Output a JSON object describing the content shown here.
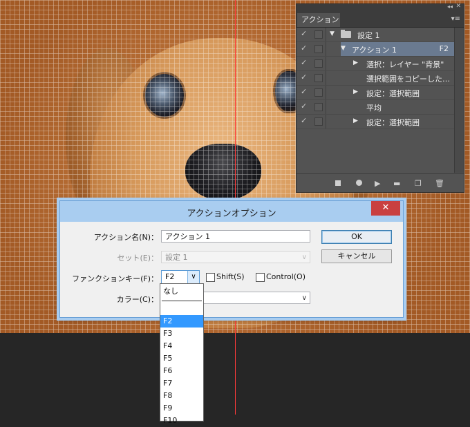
{
  "actions_panel": {
    "tab_label": "アクション",
    "menu_icon": "panel-menu-icon",
    "rows": [
      {
        "label": "設定 1",
        "key": "",
        "type": "set"
      },
      {
        "label": "アクション 1",
        "key": "F2",
        "type": "action"
      },
      {
        "label": "選択：レイヤー \"背景\"",
        "key": "",
        "type": "step"
      },
      {
        "label": "選択範囲をコピーした…",
        "key": "",
        "type": "step"
      },
      {
        "label": "設定：選択範囲",
        "key": "",
        "type": "step"
      },
      {
        "label": "平均",
        "key": "",
        "type": "step"
      },
      {
        "label": "設定：選択範囲",
        "key": "",
        "type": "step"
      }
    ],
    "bottom_icons": [
      "stop-icon",
      "record-icon",
      "play-icon",
      "new-set-icon",
      "new-action-icon",
      "trash-icon"
    ]
  },
  "dialog": {
    "title": "アクションオプション",
    "close_glyph": "✕",
    "name_label": "アクション名(N)：",
    "name_value": "アクション 1",
    "set_label": "セット(E)：",
    "set_value": "設定 1",
    "fkey_label": "ファンクションキー(F)：",
    "fkey_value": "F2",
    "shift_label": "Shift(S)",
    "control_label": "Control(O)",
    "color_label": "カラー(C)：",
    "color_value": "",
    "ok_label": "OK",
    "cancel_label": "キャンセル"
  },
  "fkey_dropdown": {
    "none_option": "なし",
    "options": [
      "F2",
      "F3",
      "F4",
      "F5",
      "F6",
      "F7",
      "F8",
      "F9",
      "F10"
    ],
    "selected": "F2"
  },
  "colors": {
    "dialog_title_bar": "#a9cdf0",
    "close_button": "#c94040",
    "selection": "#3399ff",
    "panel_bg": "#535353",
    "guide_line": "#ff3b3b"
  }
}
